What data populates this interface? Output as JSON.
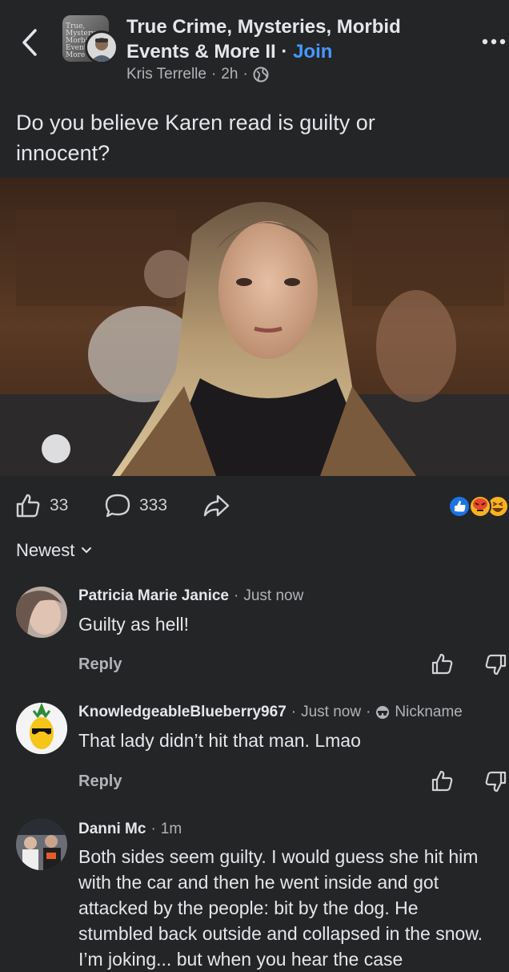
{
  "header": {
    "group_name": "True Crime, Mysteries, Morbid Events & More II",
    "join_label": "Join",
    "author": "Kris Terrelle",
    "time": "2h",
    "group_avatar_text": "True, Mystery, Morbid Events & More"
  },
  "post": {
    "text": "Do you believe Karen read is guilty or innocent?"
  },
  "actions": {
    "like_count": "33",
    "comment_count": "333"
  },
  "sort": {
    "label": "Newest"
  },
  "comments": [
    {
      "name": "Patricia Marie Janice",
      "time": "Just now",
      "text": "Guilty as hell!",
      "reply": "Reply"
    },
    {
      "name": "KnowledgeableBlueberry967",
      "time": "Just now",
      "badge": "Nickname",
      "text": "That lady didn’t hit that man. Lmao",
      "reply": "Reply"
    },
    {
      "name": "Danni Mc",
      "time": "1m",
      "text": "Both sides seem guilty. I would guess she hit him with the car and then he went inside and got attacked by the people: bit by the dog. He stumbled back outside and collapsed in the snow. I’m joking... but when you hear the case"
    }
  ],
  "colors": {
    "background": "#242526",
    "accent": "#4599ff",
    "secondary_text": "#b0b3b8"
  }
}
